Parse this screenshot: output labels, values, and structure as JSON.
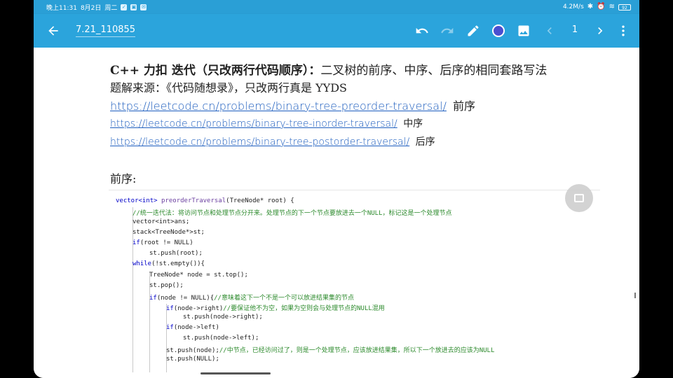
{
  "status_bar": {
    "time": "晚上11:31",
    "date": "8月2日",
    "weekday": "周二",
    "net_speed": "4.2M/s",
    "battery": "92"
  },
  "toolbar": {
    "title": "7.21_110855",
    "page": "1",
    "pen_color": "#4a4fd0"
  },
  "doc": {
    "heading_bold": "C++ 力扣 迭代（只改两行代码顺序）：",
    "heading_rest": "二叉树的前序、中序、后序的相同套路写法",
    "source": "题解来源：《代码随想录》，只改两行真是 YYDS",
    "links": [
      {
        "url": "https://leetcode.cn/problems/binary-tree-preorder-traversal/",
        "label": "前序"
      },
      {
        "url": "https://leetcode.cn/problems/binary-tree-inorder-traversal/",
        "label": "中序"
      },
      {
        "url": "https://leetcode.cn/problems/binary-tree-postorder-traversal/",
        "label": "后序"
      }
    ],
    "section": "前序:"
  },
  "code": {
    "l1_type": "vector<int> ",
    "l1_fn": "preorderTraversal",
    "l1_args": "(TreeNode* root) {",
    "l2": "//统一迭代法：将访问节点和处理节点分开来。处理节点的下一个节点要放进去一个NULL，标记这是一个处理节点",
    "l3": "vector<int>ans;",
    "l4": "stack<TreeNode*>st;",
    "l5_kw": "if",
    "l5_rest": "(root != NULL)",
    "l6": "st.push(root);",
    "l7_kw": "while",
    "l7_rest": "(!st.empty()){",
    "l8": "TreeNode* node = st.top();",
    "l9": "st.pop();",
    "l10_kw": "if",
    "l10_rest": "(node != NULL){",
    "l10_cm": "//意味着这下一个不是一个可以放进结果集的节点",
    "l11_kw": "if",
    "l11_rest": "(node->right)",
    "l11_cm": "//要保证他不为空，如果为空则会与处理节点的NULL混用",
    "l12": "st.push(node->right);",
    "l13_kw": "if",
    "l13_rest": "(node->left)",
    "l14": "st.push(node->left);",
    "l15": "st.push(node);",
    "l15_cm": "//中节点，已经访问过了，则是一个处理节点，应该放进结果集，所以下一个放进去的应该为NULL",
    "l16": "st.push(NULL);"
  }
}
